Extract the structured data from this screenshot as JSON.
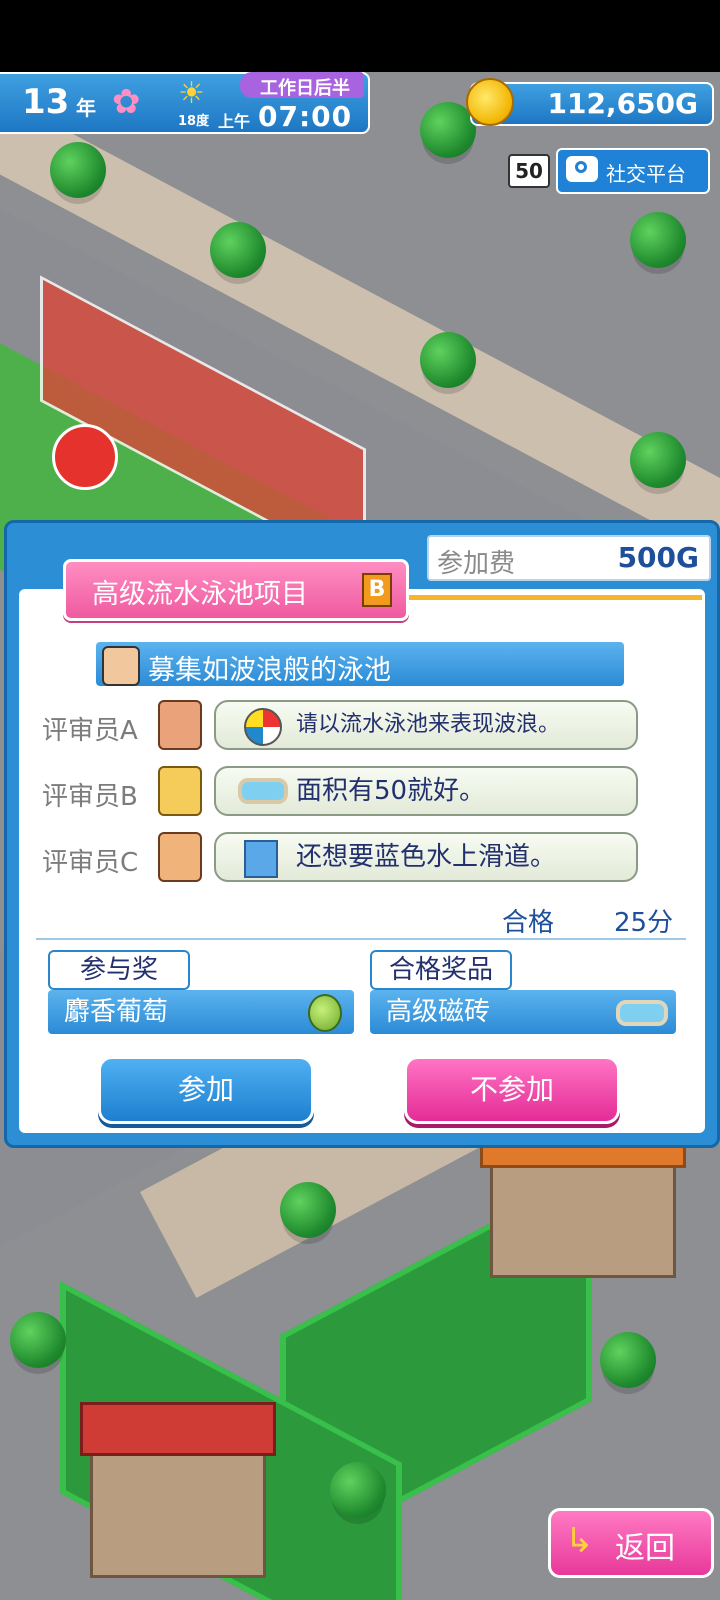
{
  "status": {
    "year_num": "13",
    "year_unit": "年",
    "period": "工作日后半",
    "temperature": "18度",
    "ampm": "上午",
    "time": "07:00",
    "money": "112,650G"
  },
  "social": {
    "count": "50",
    "label": "社交平台",
    "icon": "camera-icon"
  },
  "contest": {
    "title": "高级流水泳池项目",
    "rank": "B",
    "fee_label": "参加费",
    "fee_value": "500G",
    "theme": "募集如波浪般的泳池",
    "judges": [
      {
        "label": "评审员A",
        "comment": "请以流水泳池来表现波浪。",
        "icon": "beach-ball-icon"
      },
      {
        "label": "评审员B",
        "comment": "面积有50就好。",
        "icon": "pool-icon"
      },
      {
        "label": "评审员C",
        "comment": "还想要蓝色水上滑道。",
        "icon": "slide-icon"
      }
    ],
    "pass_label": "合格",
    "pass_score": "25分",
    "participation_tab": "参与奖",
    "participation_prize": "麝香葡萄",
    "pass_tab": "合格奖品",
    "pass_prize": "高级磁砖",
    "join_button": "参加",
    "decline_button": "不参加"
  },
  "back_button": "返回",
  "colors": {
    "panel_blue": "#2c8fd6",
    "pink": "#ef5aa0",
    "text_navy": "#23306e"
  }
}
